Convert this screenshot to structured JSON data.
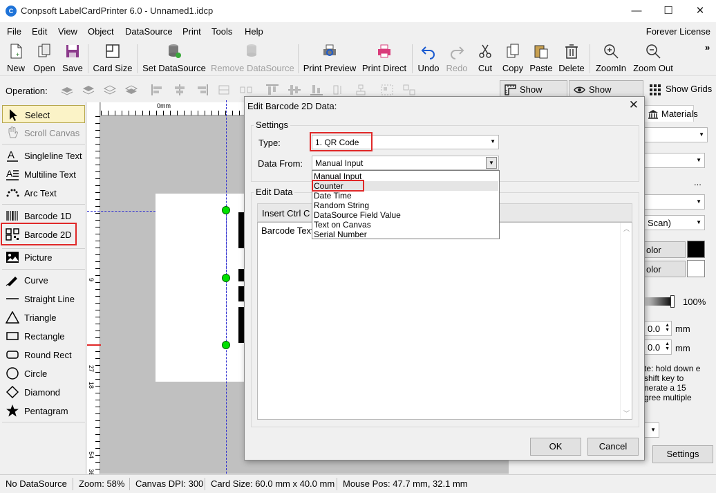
{
  "app": {
    "title": "Conpsoft LabelCardPrinter 6.0 - Unnamed1.idcp",
    "icon_text": "C",
    "window_buttons": [
      "—",
      "☐",
      "✕"
    ]
  },
  "menu": {
    "items": [
      "File",
      "Edit",
      "View",
      "Object",
      "DataSource",
      "Print",
      "Tools",
      "Help"
    ],
    "license": "Forever License"
  },
  "toolbar": {
    "new": "New",
    "open": "Open",
    "save": "Save",
    "card_size": "Card Size",
    "set_datasource": "Set DataSource",
    "remove_datasource": "Remove DataSource",
    "print_preview": "Print Preview",
    "print_direct": "Print Direct",
    "undo": "Undo",
    "redo": "Redo",
    "cut": "Cut",
    "copy": "Copy",
    "paste": "Paste",
    "delete": "Delete",
    "zoomin": "ZoomIn",
    "zoomout": "Zoom Out",
    "overflow": "»"
  },
  "operation_bar": {
    "label": "Operation:",
    "show_ruler": "Show Ruler",
    "show_guides": "Show Guides",
    "show_grids": "Show Grids"
  },
  "tools": {
    "select": "Select",
    "scroll_canvas": "Scroll Canvas",
    "singleline_text": "Singleline Text",
    "multiline_text": "Multiline Text",
    "arc_text": "Arc Text",
    "barcode_1d": "Barcode 1D",
    "barcode_2d": "Barcode 2D",
    "picture": "Picture",
    "curve": "Curve",
    "straight_line": "Straight Line",
    "triangle": "Triangle",
    "rectangle": "Rectangle",
    "round_rect": "Round Rect",
    "circle": "Circle",
    "diamond": "Diamond",
    "pentagram": "Pentagram"
  },
  "rulers": {
    "top_unit": "0mm",
    "left_marks": [
      "9",
      "18",
      "27",
      "36",
      "45",
      "54"
    ]
  },
  "right_panel": {
    "materials_tab": "Materials",
    "scan_text": "Scan)",
    "ellipsis": "...",
    "color1": "olor",
    "color2": "olor",
    "opacity": "100%",
    "val1": "0.0",
    "val2": "0.0",
    "unit": "mm",
    "note": "te: hold down e shift key to nerate a 15 gree multiple",
    "settings_btn": "Settings"
  },
  "dialog": {
    "title": "Edit Barcode 2D Data:",
    "close": "✕",
    "settings_group": "Settings",
    "type_label": "Type:",
    "type_value": "1.  QR Code",
    "datafrom_label": "Data From:",
    "datafrom_value": "Manual Input",
    "dropdown_options": [
      "Manual Input",
      "Counter",
      "Date Time",
      "Random String",
      "DataSource Field Value",
      "Text on Canvas",
      "Serial Number"
    ],
    "edit_group": "Edit Data",
    "insert_ctrl": "Insert Ctrl C",
    "text_value": "Barcode Text",
    "ok": "OK",
    "cancel": "Cancel"
  },
  "status": {
    "datasource": "No DataSource",
    "zoom": "Zoom: 58%",
    "dpi": "Canvas DPI: 300",
    "card_size": "Card Size: 60.0 mm x 40.0 mm",
    "mouse_pos": "Mouse Pos: 47.7 mm, 32.1 mm"
  },
  "colors": {
    "highlight_red": "#e02828",
    "select_tool_bg": "#fbf3c7",
    "handle_green": "#00e000"
  }
}
